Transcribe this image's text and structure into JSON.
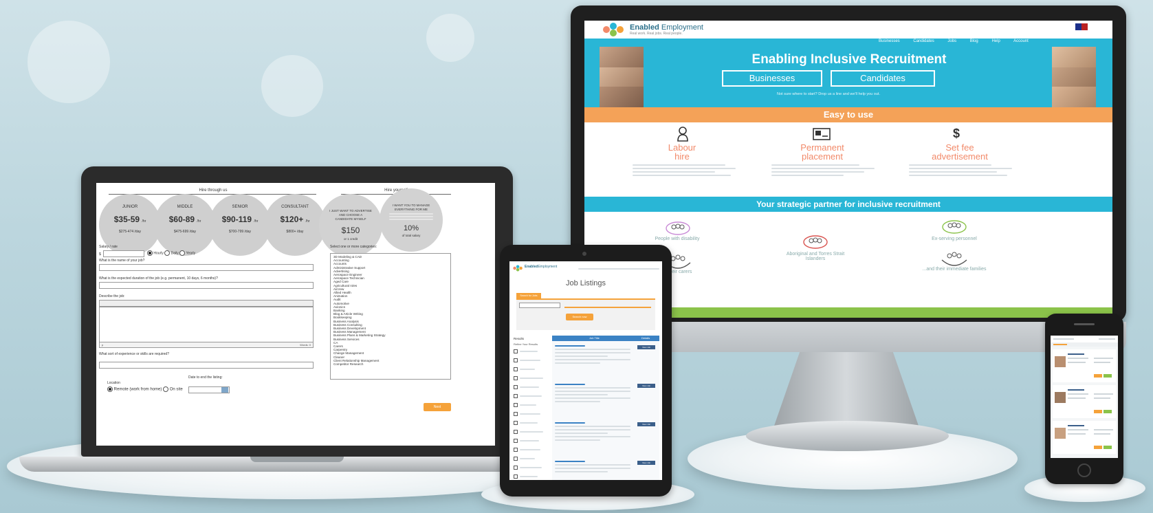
{
  "laptop": {
    "hire_through_us": "Hire through us",
    "hire_yourself": "Hire yourself",
    "plans": [
      {
        "name": "JUNIOR",
        "hourly": "$35-59",
        "hourly_unit": "/hr",
        "daily": "$275-474",
        "daily_unit": "/day"
      },
      {
        "name": "MIDDLE",
        "hourly": "$60-89",
        "hourly_unit": "/hr",
        "daily": "$475-699",
        "daily_unit": "/day"
      },
      {
        "name": "SENIOR",
        "hourly": "$90-119",
        "hourly_unit": "/hr",
        "daily": "$700-799",
        "daily_unit": "/day"
      },
      {
        "name": "CONSULTANT",
        "hourly": "$120+",
        "hourly_unit": "/hr",
        "daily": "$800+",
        "daily_unit": "/day"
      }
    ],
    "self_options": [
      {
        "line1": "I JUST WANT TO ADVERTISE",
        "line2": "AND CHOOSE A",
        "line3": "CANDIDATE MYSELF",
        "price": "$150",
        "note": "or 1 credit"
      },
      {
        "line1": "I WANT YOU TO MANAGE",
        "line2": "EVERYTHING FOR ME",
        "line3": "",
        "price": "10%",
        "note": "of total salary"
      }
    ],
    "salary_label": "Salary / rate",
    "currency": "$",
    "rate_options": [
      "Hourly",
      "Daily",
      "Yearly"
    ],
    "job_name_label": "What is the name of your job?",
    "duration_label": "What is the expected duration of the job (e.g. permanent, 10 days, 6 months)?",
    "describe_label": "Describe the job:",
    "words_label": "Words: 0",
    "editor_path": "p",
    "experience_label": "What sort of experience or skills are required?",
    "location_label": "Location",
    "date_label": "Date to end the listing:",
    "location_options": [
      "Remote (work from home)",
      "On site"
    ],
    "categories_label": "Select one or more categories:",
    "categories": [
      "3D Modeling & CAD",
      "Accounting",
      "Accounts",
      "Administrative Support",
      "Advertising",
      "Aerospace Engineer",
      "Aerospace Technician",
      "Aged Care",
      "Agricultural roles",
      "Aircrew",
      "Allied Health",
      "Animation",
      "Audit",
      "Automotive",
      "Avionics",
      "Banking",
      "Blog & Article Writing",
      "Bookkeeping",
      "Business Analysis",
      "Business Consulting",
      "Business Development",
      "Business Management",
      "Business Plans & Marketing Strategy",
      "Business Services",
      "CA",
      "Carers",
      "Carpentry",
      "Change Management",
      "Cleaner",
      "Client Relationship Management",
      "Competitor Research"
    ],
    "next_label": "Next"
  },
  "monitor": {
    "brand_name_bold": "Enabled",
    "brand_name_light": "Employment",
    "tagline": "Real work. Real jobs. Real people.",
    "nav": [
      "Businesses",
      "Candidates",
      "Jobs",
      "Blog",
      "Help",
      "Account"
    ],
    "hero_title": "Enabling Inclusive Recruitment",
    "hero_buttons": [
      "Businesses",
      "Candidates"
    ],
    "hero_hint": "Not sure where to start? Drop us a line and we'll help you out.",
    "easy_label": "Easy to use",
    "services": [
      {
        "icon": "person",
        "title1": "Labour",
        "title2": "hire"
      },
      {
        "icon": "id-card",
        "title1": "Permanent",
        "title2": "placement"
      },
      {
        "icon": "dollar",
        "title1": "Set fee",
        "title2": "advertisement"
      }
    ],
    "partner_title": "Your strategic partner for inclusive recruitment",
    "partner_captions": [
      "People with disability",
      "Aboriginal and Torres Strait Islanders",
      "Ex-serving personnel",
      "...their carers",
      "...and their immediate families"
    ]
  },
  "tablet": {
    "title": "Job Listings",
    "search_tab": "Search for Jobs",
    "search_button": "Search now",
    "table_headers": [
      "Job Title",
      "Details"
    ],
    "view_label": "View Job",
    "sidebar_heading": "Results",
    "sidebar_sub": "Refine Your Results"
  },
  "colors": {
    "teal": "#29b6d6",
    "orange": "#f4a258",
    "coral": "#f28a6a",
    "cta_orange": "#f5a23a",
    "green": "#8bc34a"
  }
}
